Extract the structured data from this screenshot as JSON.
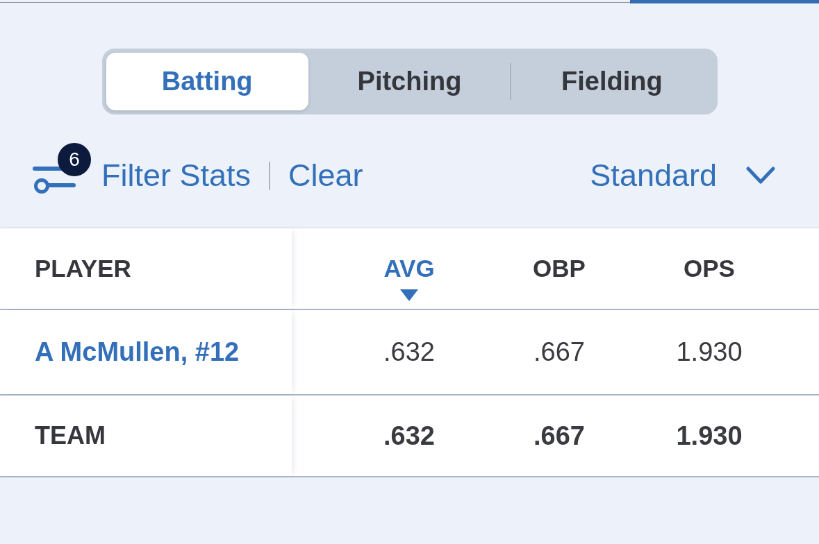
{
  "segments": [
    {
      "label": "Batting",
      "selected": true
    },
    {
      "label": "Pitching",
      "selected": false
    },
    {
      "label": "Fielding",
      "selected": false
    }
  ],
  "filter_bar": {
    "filter_button": "Filter Stats",
    "badge": "6",
    "clear_button": "Clear",
    "view_select": "Standard"
  },
  "table": {
    "columns": [
      {
        "label": "PLAYER",
        "sorted": false
      },
      {
        "label": "AVG",
        "sorted": true
      },
      {
        "label": "OBP",
        "sorted": false
      },
      {
        "label": "OPS",
        "sorted": false
      }
    ],
    "rows": [
      {
        "kind": "player",
        "cells": [
          "A McMullen, #12",
          ".632",
          ".667",
          "1.930"
        ]
      },
      {
        "kind": "total",
        "cells": [
          "TEAM",
          ".632",
          ".667",
          "1.930"
        ]
      }
    ]
  }
}
